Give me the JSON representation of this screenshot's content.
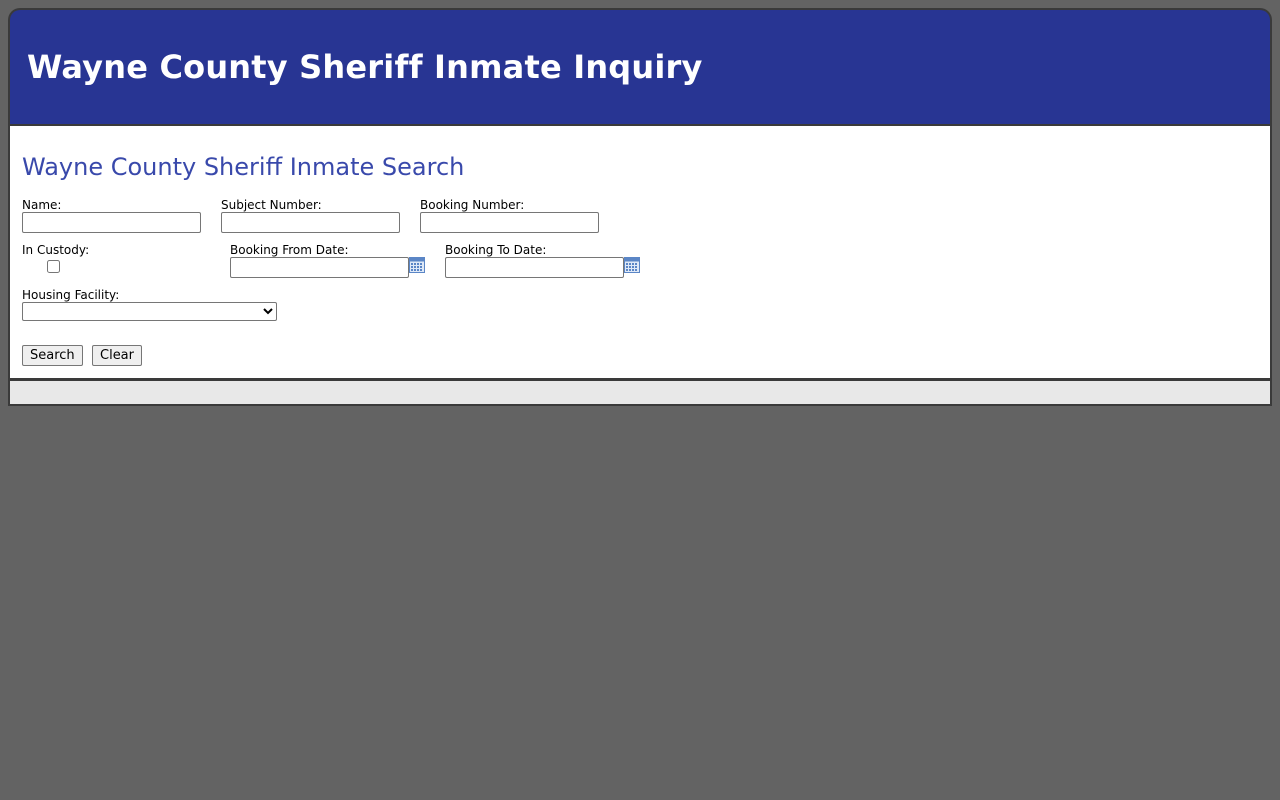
{
  "header": {
    "title": "Wayne County Sheriff Inmate Inquiry"
  },
  "form": {
    "title": "Wayne County Sheriff Inmate Search",
    "name_label": "Name:",
    "name_value": "",
    "subject_number_label": "Subject Number:",
    "subject_number_value": "",
    "booking_number_label": "Booking Number:",
    "booking_number_value": "",
    "in_custody_label": "In Custody:",
    "in_custody_checked": false,
    "booking_from_label": "Booking From Date:",
    "booking_from_value": "",
    "booking_to_label": "Booking To Date:",
    "booking_to_value": "",
    "housing_facility_label": "Housing Facility:",
    "housing_facility_selected": "",
    "search_label": "Search",
    "clear_label": "Clear"
  },
  "icons": {
    "calendar": "calendar-icon"
  },
  "colors": {
    "banner": "#283593",
    "page_title": "#3949ab",
    "background": "#636363",
    "footer": "#e8e8e8",
    "calendar_icon": "#5b86c6"
  }
}
